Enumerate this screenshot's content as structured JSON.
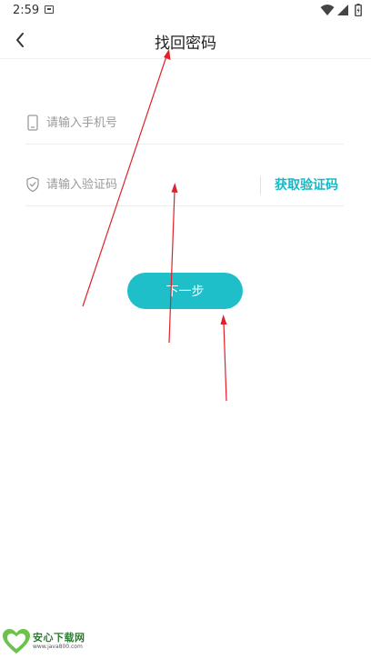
{
  "status_bar": {
    "time": "2:59"
  },
  "header": {
    "title": "找回密码"
  },
  "form": {
    "phone_placeholder": "请输入手机号",
    "code_placeholder": "请输入验证码",
    "get_code_label": "获取验证码"
  },
  "actions": {
    "next_label": "下一步"
  },
  "watermark": {
    "name": "安心下载网",
    "url": "www.java800.com"
  },
  "colors": {
    "accent": "#1ebfc9",
    "link": "#15b8c6",
    "annotation_arrow": "#e0202a",
    "watermark_green": "#2c7c32"
  }
}
